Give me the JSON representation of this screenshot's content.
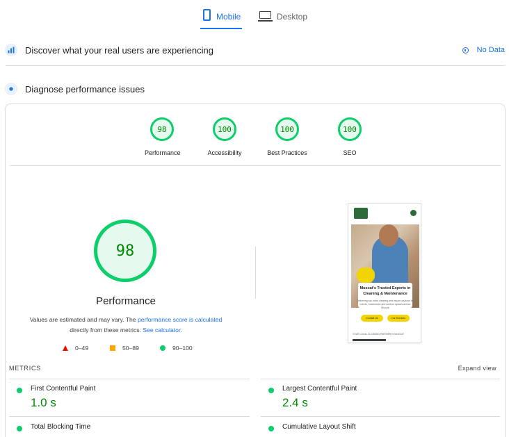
{
  "tabs": {
    "mobile": "Mobile",
    "desktop": "Desktop"
  },
  "crux": {
    "title": "Discover what your real users are experiencing",
    "status": "No Data"
  },
  "diagnose": {
    "title": "Diagnose performance issues"
  },
  "gauges": [
    {
      "score": "98",
      "label": "Performance"
    },
    {
      "score": "100",
      "label": "Accessibility"
    },
    {
      "score": "100",
      "label": "Best Practices"
    },
    {
      "score": "100",
      "label": "SEO"
    }
  ],
  "performance": {
    "score": "98",
    "label": "Performance",
    "desc_1": "Values are estimated and may vary. The ",
    "desc_link_1": "performance score is calculated",
    "desc_2": " directly from these metrics. ",
    "desc_link_2": "See calculator."
  },
  "legend": {
    "fail": "0–49",
    "average": "50–89",
    "pass": "90–100"
  },
  "thumbnail": {
    "heading": "Muscat's Trusted Experts in Cleaning & Maintenance",
    "subtext": "Delivering top-notch cleaning and repair solutions for homes, businesses and outdoor spaces across Muscat",
    "button_1": "Contact Us",
    "button_2": "Our Services",
    "footer": "YOUR LOCAL CLEANING PARTNER IN MUSCAT"
  },
  "metrics": {
    "title": "METRICS",
    "expand": "Expand view",
    "items": [
      {
        "name": "First Contentful Paint",
        "value": "1.0 s"
      },
      {
        "name": "Largest Contentful Paint",
        "value": "2.4 s"
      },
      {
        "name": "Total Blocking Time",
        "value": ""
      },
      {
        "name": "Cumulative Layout Shift",
        "value": ""
      }
    ]
  },
  "colors": {
    "accent": "#1a73e8",
    "pass": "#0cce6b",
    "pass_text": "#008800",
    "average": "#ffa400",
    "fail": "#eb0f00"
  }
}
